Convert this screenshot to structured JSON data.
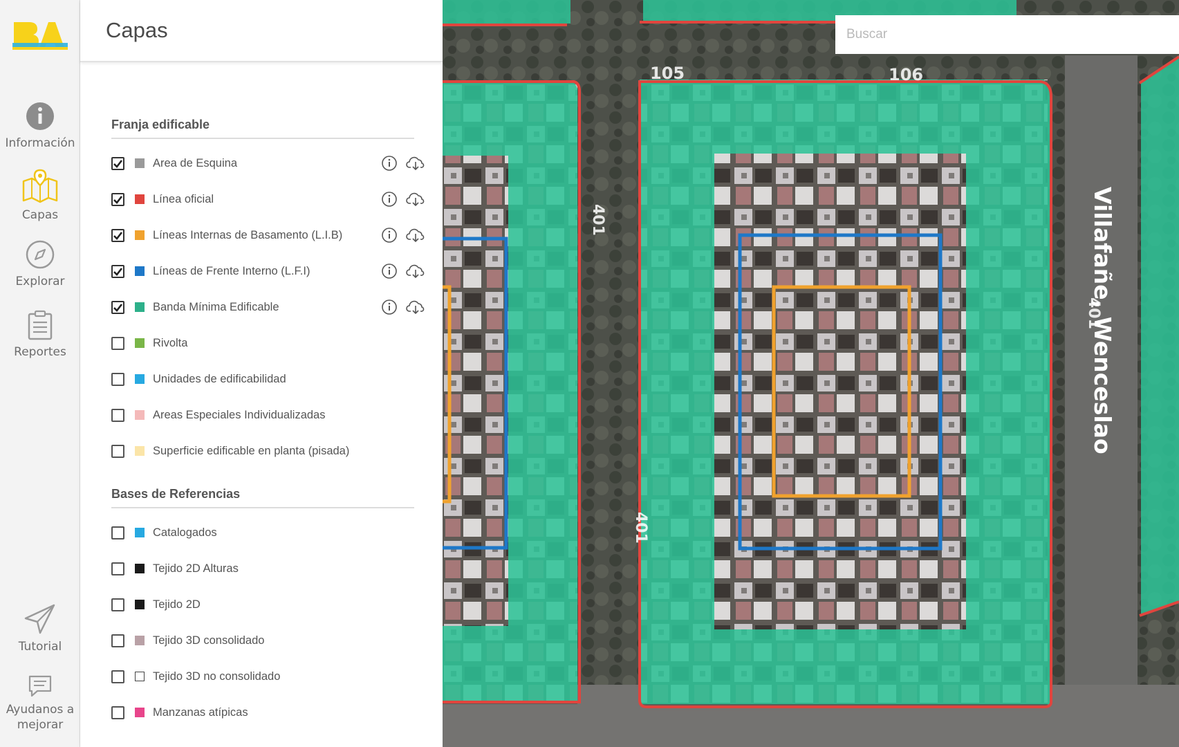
{
  "rail": {
    "items": [
      {
        "label": "Información",
        "icon": "info-icon"
      },
      {
        "label": "Capas",
        "icon": "map-layers-icon",
        "active": true
      },
      {
        "label": "Explorar",
        "icon": "compass-icon"
      },
      {
        "label": "Reportes",
        "icon": "clipboard-icon"
      },
      {
        "label": "Tutorial",
        "icon": "paper-plane-icon"
      },
      {
        "label_line1": "Ayudanos a",
        "label_line2": "mejorar",
        "icon": "feedback-icon"
      }
    ]
  },
  "panel": {
    "title": "Capas",
    "sections": [
      {
        "title": "Franja edificable",
        "layers": [
          {
            "label": "Area de Esquina",
            "checked": true,
            "color": "#9a9a9a",
            "actions": true
          },
          {
            "label": "Línea oficial",
            "checked": true,
            "color": "#e0453e",
            "actions": true
          },
          {
            "label": "Líneas Internas de Basamento (L.I.B)",
            "checked": true,
            "color": "#f0a22e",
            "actions": true
          },
          {
            "label": "Líneas de Frente Interno (L.F.I)",
            "checked": true,
            "color": "#1e78c8",
            "actions": true
          },
          {
            "label": "Banda Mínima Edificable",
            "checked": true,
            "color": "#2db08a",
            "actions": true
          },
          {
            "label": "Rivolta",
            "checked": false,
            "color": "#7ab648"
          },
          {
            "label": "Unidades de edificabilidad",
            "checked": false,
            "color": "#27a9e1"
          },
          {
            "label": "Areas Especiales Individualizadas",
            "checked": false,
            "color": "#f4b9b9"
          },
          {
            "label": "Superficie edificable en planta (pisada)",
            "checked": false,
            "color": "#fbe5a8"
          }
        ]
      },
      {
        "title": "Bases de Referencias",
        "layers": [
          {
            "label": "Catalogados",
            "checked": false,
            "color": "#27a9e1"
          },
          {
            "label": "Tejido 2D Alturas",
            "checked": false,
            "color": "#1a1a1a"
          },
          {
            "label": "Tejido 2D",
            "checked": false,
            "color": "#1a1a1a"
          },
          {
            "label": "Tejido 3D consolidado",
            "checked": false,
            "color": "#b9a1a6"
          },
          {
            "label": "Tejido 3D no consolidado",
            "checked": false,
            "color": "#ffffff"
          },
          {
            "label": "Manzanas atípicas",
            "checked": false,
            "color": "#e8458b"
          }
        ]
      }
    ]
  },
  "map": {
    "search_placeholder": "Buscar",
    "street_label": "Villafañe, Wenceslao",
    "street_numbers": [
      "105",
      "106",
      "401",
      "401",
      "401"
    ],
    "colors": {
      "buildable_band": "#2cc296",
      "official_line": "#e0453e",
      "lib_line": "#f0a22e",
      "lfi_line": "#1e78c8"
    }
  }
}
